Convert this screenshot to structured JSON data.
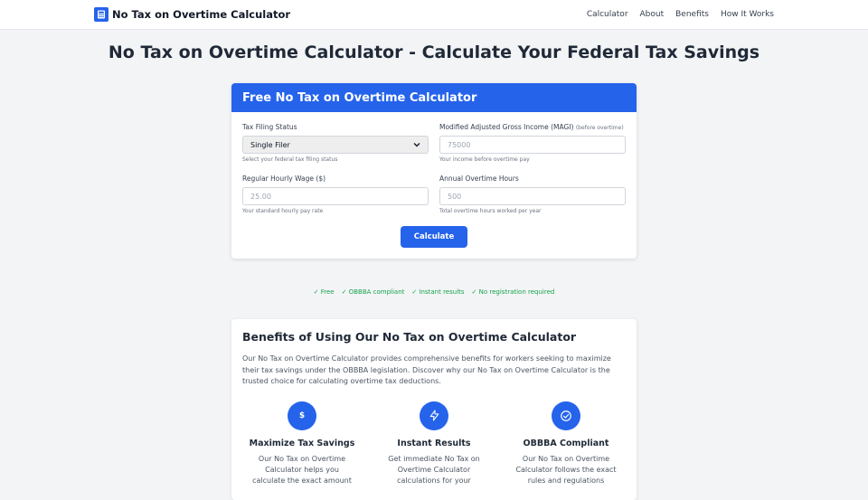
{
  "nav": {
    "brand": "No Tax on Overtime Calculator",
    "links": [
      "Calculator",
      "About",
      "Benefits",
      "How It Works"
    ]
  },
  "page_title": "No Tax on Overtime Calculator - Calculate Your Federal Tax Savings",
  "calculator": {
    "header": "Free No Tax on Overtime Calculator",
    "filing_status": {
      "label": "Tax Filing Status",
      "value": "Single Filer",
      "help": "Select your federal tax filing status"
    },
    "magi": {
      "label": "Modified Adjusted Gross Income (MAGI)",
      "hint": "(before overtime)",
      "placeholder": "75000",
      "help": "Your income before overtime pay"
    },
    "wage": {
      "label": "Regular Hourly Wage ($)",
      "placeholder": "25.00",
      "help": "Your standard hourly pay rate"
    },
    "hours": {
      "label": "Annual Overtime Hours",
      "placeholder": "500",
      "help": "Total overtime hours worked per year"
    },
    "button": "Calculate"
  },
  "features": [
    "✓ Free",
    "✓ OBBBA compliant",
    "✓ Instant results",
    "✓ No registration required"
  ],
  "benefits": {
    "title": "Benefits of Using Our No Tax on Overtime Calculator",
    "intro": "Our No Tax on Overtime Calculator provides comprehensive benefits for workers seeking to maximize their tax savings under the OBBBA legislation. Discover why our No Tax on Overtime Calculator is the trusted choice for calculating overtime tax deductions.",
    "items": [
      {
        "icon": "dollar-icon",
        "glyph": "$",
        "title": "Maximize Tax Savings",
        "text": "Our No Tax on Overtime Calculator helps you calculate the exact amount"
      },
      {
        "icon": "lightning-icon",
        "glyph": "",
        "title": "Instant Results",
        "text": "Get immediate No Tax on Overtime Calculator calculations for your"
      },
      {
        "icon": "check-circle-icon",
        "glyph": "",
        "title": "OBBBA Compliant",
        "text": "Our No Tax on Overtime Calculator follows the exact rules and regulations"
      }
    ]
  },
  "colors": {
    "primary": "#2563eb",
    "success": "#16a34a"
  }
}
